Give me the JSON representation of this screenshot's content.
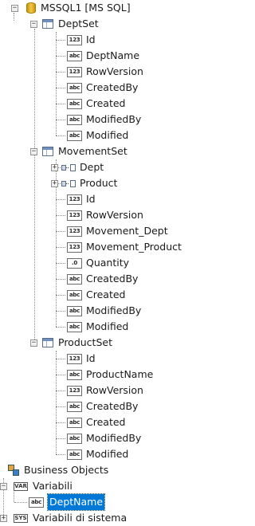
{
  "connection": {
    "label": "MSSQL1 [MS SQL]"
  },
  "tables": [
    {
      "name": "DeptSet",
      "fields": [
        {
          "type": "123",
          "name": "Id"
        },
        {
          "type": "abc",
          "name": "DeptName"
        },
        {
          "type": "123",
          "name": "RowVersion"
        },
        {
          "type": "abc",
          "name": "CreatedBy"
        },
        {
          "type": "abc",
          "name": "Created"
        },
        {
          "type": "abc",
          "name": "ModifiedBy"
        },
        {
          "type": "abc",
          "name": "Modified"
        }
      ]
    },
    {
      "name": "MovementSet",
      "relations": [
        {
          "name": "Dept"
        },
        {
          "name": "Product"
        }
      ],
      "fields": [
        {
          "type": "123",
          "name": "Id"
        },
        {
          "type": "123",
          "name": "RowVersion"
        },
        {
          "type": "123",
          "name": "Movement_Dept"
        },
        {
          "type": "123",
          "name": "Movement_Product"
        },
        {
          "type": ".0",
          "name": "Quantity"
        },
        {
          "type": "abc",
          "name": "CreatedBy"
        },
        {
          "type": "abc",
          "name": "Created"
        },
        {
          "type": "abc",
          "name": "ModifiedBy"
        },
        {
          "type": "abc",
          "name": "Modified"
        }
      ]
    },
    {
      "name": "ProductSet",
      "fields": [
        {
          "type": "123",
          "name": "Id"
        },
        {
          "type": "abc",
          "name": "ProductName"
        },
        {
          "type": "123",
          "name": "RowVersion"
        },
        {
          "type": "abc",
          "name": "CreatedBy"
        },
        {
          "type": "abc",
          "name": "Created"
        },
        {
          "type": "abc",
          "name": "ModifiedBy"
        },
        {
          "type": "abc",
          "name": "Modified"
        }
      ]
    }
  ],
  "business_objects": {
    "label": "Business Objects"
  },
  "variables": {
    "label": "Variabili",
    "icon_text": "VAR",
    "items": [
      {
        "type": "abc",
        "name": "DeptName",
        "selected": true
      }
    ]
  },
  "system_variables": {
    "label": "Variabili di sistema",
    "icon_text": "SYS"
  },
  "colors": {
    "selection": "#0078d7",
    "db_icon": "#f5c84a",
    "table_icon": "#6f8fbf"
  }
}
